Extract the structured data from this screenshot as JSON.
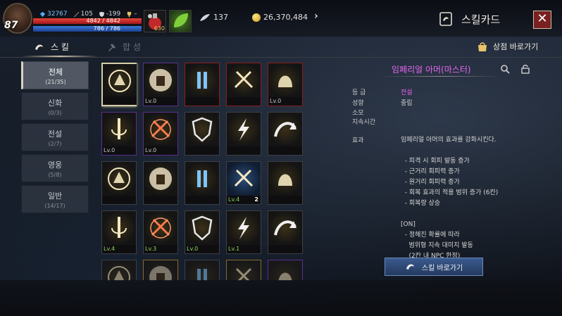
{
  "player": {
    "level": "87",
    "crystal": "32767",
    "attack": "105",
    "defense": "-199",
    "trophy": "–",
    "hp_text": "4842 / 4842",
    "hp_fraction": 1.0,
    "mp_text": "786 / 786",
    "mp_fraction": 1.0,
    "potion_count": "630"
  },
  "currency": {
    "feathers": "137",
    "gold": "26,370,484"
  },
  "header": {
    "title": "스킬카드",
    "close_label": "✕",
    "more_label": "›"
  },
  "tabs": {
    "skill_label": "스 킬",
    "synth_label": "합 성",
    "shop_link_label": "상점 바로가기"
  },
  "categories": [
    {
      "name": "전체",
      "count": "(21/35)",
      "active": true
    },
    {
      "name": "신화",
      "count": "(0/3)",
      "active": false
    },
    {
      "name": "전설",
      "count": "(2/7)",
      "active": false
    },
    {
      "name": "영웅",
      "count": "(5/8)",
      "active": false
    },
    {
      "name": "일반",
      "count": "(14/17)",
      "active": false
    }
  ],
  "cards": [
    {
      "icon": "armor-skill-icon",
      "caption": "",
      "count": "",
      "frame": "sel"
    },
    {
      "icon": "fist-skill-icon",
      "caption": "Lv.0",
      "count": "",
      "frame": "purple"
    },
    {
      "icon": "pillar-skill-icon",
      "caption": "",
      "count": "",
      "frame": "red"
    },
    {
      "icon": "crossed-swords-skill-icon",
      "caption": "",
      "count": "",
      "frame": "red"
    },
    {
      "icon": "helmet-skill-icon",
      "caption": "Lv.0",
      "count": "",
      "frame": "red"
    },
    {
      "icon": "sword-skill-icon",
      "caption": "Lv.0",
      "count": "",
      "frame": "purple"
    },
    {
      "icon": "flame-swords-skill-icon",
      "caption": "Lv.0",
      "count": "",
      "frame": "purple"
    },
    {
      "icon": "shield-skill-icon",
      "caption": "",
      "count": "",
      "frame": ""
    },
    {
      "icon": "lightning-skill-icon",
      "caption": "",
      "count": "",
      "frame": ""
    },
    {
      "icon": "arc-arrow-skill-icon",
      "caption": "",
      "count": "",
      "frame": ""
    },
    {
      "icon": "burst-skill-icon",
      "caption": "",
      "count": "",
      "frame": ""
    },
    {
      "icon": "anvil-skill-icon",
      "caption": "",
      "count": "",
      "frame": ""
    },
    {
      "icon": "blue-pillar-skill-icon",
      "caption": "",
      "count": "",
      "frame": ""
    },
    {
      "icon": "blue-glyph-skill-icon",
      "caption": "Lv.4",
      "count": "2",
      "frame": "ltblue"
    },
    {
      "icon": "target-skill-icon",
      "caption": "",
      "count": "",
      "frame": ""
    },
    {
      "icon": "ankh-skill-icon",
      "caption": "Lv.4",
      "count": "",
      "frame": ""
    },
    {
      "icon": "spark-wing-skill-icon",
      "caption": "Lv.3",
      "count": "",
      "frame": ""
    },
    {
      "icon": "crowned-armor-skill-icon",
      "caption": "Lv.0",
      "count": "",
      "frame": ""
    },
    {
      "icon": "chevron-rank-skill-icon",
      "caption": "Lv.1",
      "count": "",
      "frame": ""
    },
    {
      "icon": "feather-wing-skill-icon",
      "caption": "",
      "count": "",
      "frame": ""
    },
    {
      "icon": "blue-arrows-skill-icon",
      "caption": "",
      "count": "",
      "frame": ""
    },
    {
      "icon": "round-skill-icon",
      "caption": "",
      "count": "",
      "frame": "gold"
    },
    {
      "icon": "star-burst-skill-icon",
      "caption": "",
      "count": "",
      "frame": ""
    },
    {
      "icon": "red-flame-skill-icon",
      "caption": "",
      "count": "",
      "frame": "gold"
    },
    {
      "icon": "purple-pillars-skill-icon",
      "caption": "",
      "count": "",
      "frame": "purple"
    }
  ],
  "detail": {
    "name": "임페리얼 아머(마스터)",
    "grade_label": "등 급",
    "grade_value": "전설",
    "align_label": "성향",
    "align_value": "중립",
    "cost_label": "소모",
    "duration_label": "지속시간",
    "effect_label": "효과",
    "effect_text": "임페리얼 아머의 효과를 강화시킨다.\n\n  - 피격 시 회피 발동 증가\n  - 근거리 회피력 증가\n  - 원거리 회피력 증가\n  - 회복 효과의 적용 범위 증가 (6칸)\n  - 회복량 상승\n\n[ON]\n  - 정해진 확률에 따라\n    범위형 지속 대미지 발동\n    (2칸 내 NPC 한정)",
    "go_skill_label": "스킬 바로가기"
  },
  "colors": {
    "legend": "#e566ef",
    "hp": "#e8433a",
    "mp": "#3a7ad8",
    "close_bg": "#7a2020",
    "button": "#2e4a78"
  }
}
